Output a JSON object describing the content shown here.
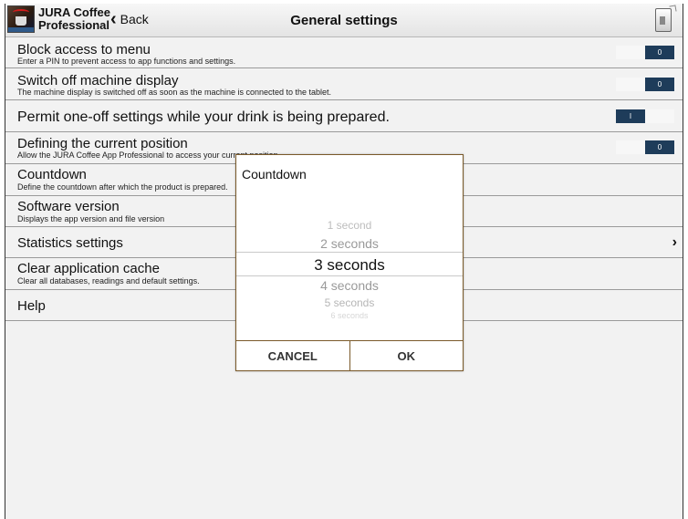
{
  "header": {
    "app_name_line1": "JURA Coffee",
    "app_name_line2": "Professional",
    "back_label": "Back",
    "title": "General settings"
  },
  "settings": [
    {
      "title": "Block access to menu",
      "subtitle": "Enter a PIN to prevent access to app functions and settings.",
      "toggle": "0"
    },
    {
      "title": "Switch off machine display",
      "subtitle": "The machine display is switched off as soon as the machine is connected to the tablet.",
      "toggle": "0"
    },
    {
      "title": "Permit one-off settings while your drink is being prepared.",
      "toggle": "I"
    },
    {
      "title": "Defining the current position",
      "subtitle": "Allow the JURA Coffee App Professional to access your current position.",
      "toggle": "0"
    },
    {
      "title": "Countdown",
      "subtitle": "Define the countdown after which the product is prepared."
    },
    {
      "title": "Software version",
      "subtitle": "Displays the app version and file version"
    },
    {
      "title": "Statistics settings"
    },
    {
      "title": "Clear application cache",
      "subtitle": "Clear all databases, readings and default settings."
    },
    {
      "title": "Help"
    }
  ],
  "dialog": {
    "title": "Countdown",
    "options": [
      "1 second",
      "2 seconds",
      "3 seconds",
      "4 seconds",
      "5 seconds",
      "6 seconds"
    ],
    "selected": "3 seconds",
    "cancel_label": "CANCEL",
    "ok_label": "OK"
  },
  "colors": {
    "toggle_dark": "#1e3c5a",
    "dialog_border": "#7a5a2a",
    "background": "#f2f2f2"
  }
}
